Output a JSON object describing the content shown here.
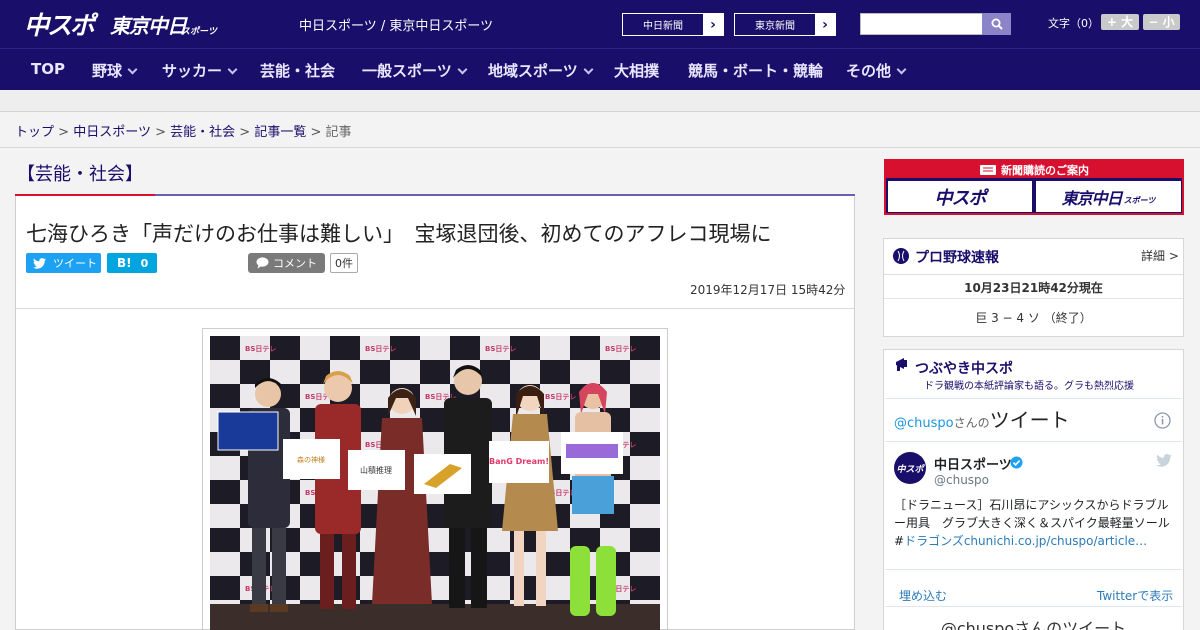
{
  "header": {
    "logo_chuspo": "中スポ",
    "logo_tokyo": "東京中日",
    "logo_tokyo_sub": "スポーツ",
    "site_title": "中日スポーツ / 東京中日スポーツ",
    "btn_chunichi": "中日新聞",
    "btn_tokyo": "東京新聞",
    "btn_arrow": "›",
    "search_placeholder": "",
    "font_size_label": "文字（0）",
    "font_larger": "+ 大",
    "font_smaller": "− 小"
  },
  "nav": {
    "items": [
      {
        "label": "TOP"
      },
      {
        "label": "野球"
      },
      {
        "label": "サッカー"
      },
      {
        "label": "芸能・社会"
      },
      {
        "label": "一般スポーツ"
      },
      {
        "label": "地域スポーツ"
      },
      {
        "label": "大相撲"
      },
      {
        "label": "競馬・ボート・競輪"
      },
      {
        "label": "その他"
      }
    ]
  },
  "breadcrumb": {
    "items": [
      "トップ",
      "中日スポーツ",
      "芸能・社会",
      "記事一覧",
      "記事"
    ],
    "sep": ">"
  },
  "article": {
    "category": "【芸能・社会】",
    "title": "七海ひろき「声だけのお仕事は難しい」　宝塚退団後、初めてのアフレコ現場に",
    "tweet_label": "ツイート",
    "hatena_label": "B!",
    "hatena_count": "0",
    "comment_label": "コメント",
    "comment_count": "0件",
    "date": "2019年12月17日 15時42分",
    "photo_backdrop_text": "BS日テレ",
    "photo_boards": [
      "",
      "森の神様",
      "山積推理",
      "",
      "BanG Dream!",
      ""
    ]
  },
  "sidebar": {
    "subscribe_header": "新聞購読のご案内",
    "subscribe_chuspo": "中スポ",
    "subscribe_tokyo": "東京中日",
    "subscribe_tokyo_sub": "スポーツ",
    "baseball_title": "プロ野球速報",
    "baseball_more": "詳細 >",
    "baseball_time": "10月23日21時42分現在",
    "baseball_score": "巨 3 − 4 ソ （終了）",
    "tsubuyaki_title": "つぶやき中スポ",
    "tsubuyaki_sub": "ドラ観戦の本紙評論家も語る。グラも熱烈応援",
    "tw_handle_prefix": "@chuspo",
    "tw_handle_mid": "さんの",
    "tw_handle_suffix": "ツイート",
    "tw_name": "中日スポーツ",
    "tw_user": "@chuspo",
    "tw_avatar_text": "中スポ",
    "tw_text": "［ドラニュース］石川昂にアシックスからドラブルー用具　グラブ大きく深く＆スパイク最軽量ソール#",
    "tw_link": "ドラゴンズchunichi.co.jp/chuspo/article…",
    "tw_embed": "埋め込む",
    "tw_view": "Twitterで表示",
    "tw_footer": "@chuspoさんのツイート"
  },
  "colors": {
    "navy": "#1a0e6b",
    "red": "#d7102f",
    "twitter": "#1da1f2",
    "hatena": "#00a4de"
  }
}
